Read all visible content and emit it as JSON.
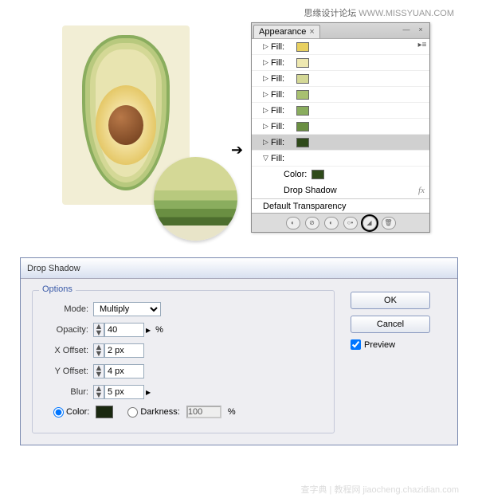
{
  "watermark_top": {
    "cn": "思缘设计论坛",
    "en": "WWW.MISSYUAN.COM"
  },
  "watermark_bottom": "查字典 | 教程网 jiaocheng.chazidian.com",
  "appearance": {
    "tab_label": "Appearance",
    "fills": [
      {
        "label": "Fill:",
        "color": "#e8d060"
      },
      {
        "label": "Fill:",
        "color": "#eee8b0"
      },
      {
        "label": "Fill:",
        "color": "#d4d896"
      },
      {
        "label": "Fill:",
        "color": "#a8c070"
      },
      {
        "label": "Fill:",
        "color": "#8aad5e"
      },
      {
        "label": "Fill:",
        "color": "#6a8f42"
      },
      {
        "label": "Fill:",
        "color": "#2f4a1a"
      }
    ],
    "expanded": {
      "label": "Fill:",
      "color_label": "Color:",
      "color": "#2f4a1a",
      "effect": "Drop Shadow",
      "fx": "fx"
    },
    "default_transparency": "Default Transparency"
  },
  "dialog": {
    "title": "Drop Shadow",
    "options_label": "Options",
    "mode": {
      "label": "Mode:",
      "value": "Multiply"
    },
    "opacity": {
      "label": "Opacity:",
      "value": "40",
      "unit": "%"
    },
    "xoffset": {
      "label": "X Offset:",
      "value": "2 px"
    },
    "yoffset": {
      "label": "Y Offset:",
      "value": "4 px"
    },
    "blur": {
      "label": "Blur:",
      "value": "5 px"
    },
    "color_label": "Color:",
    "color_value": "#1a2810",
    "darkness_label": "Darkness:",
    "darkness_value": "100",
    "darkness_unit": "%",
    "ok": "OK",
    "cancel": "Cancel",
    "preview": "Preview"
  }
}
